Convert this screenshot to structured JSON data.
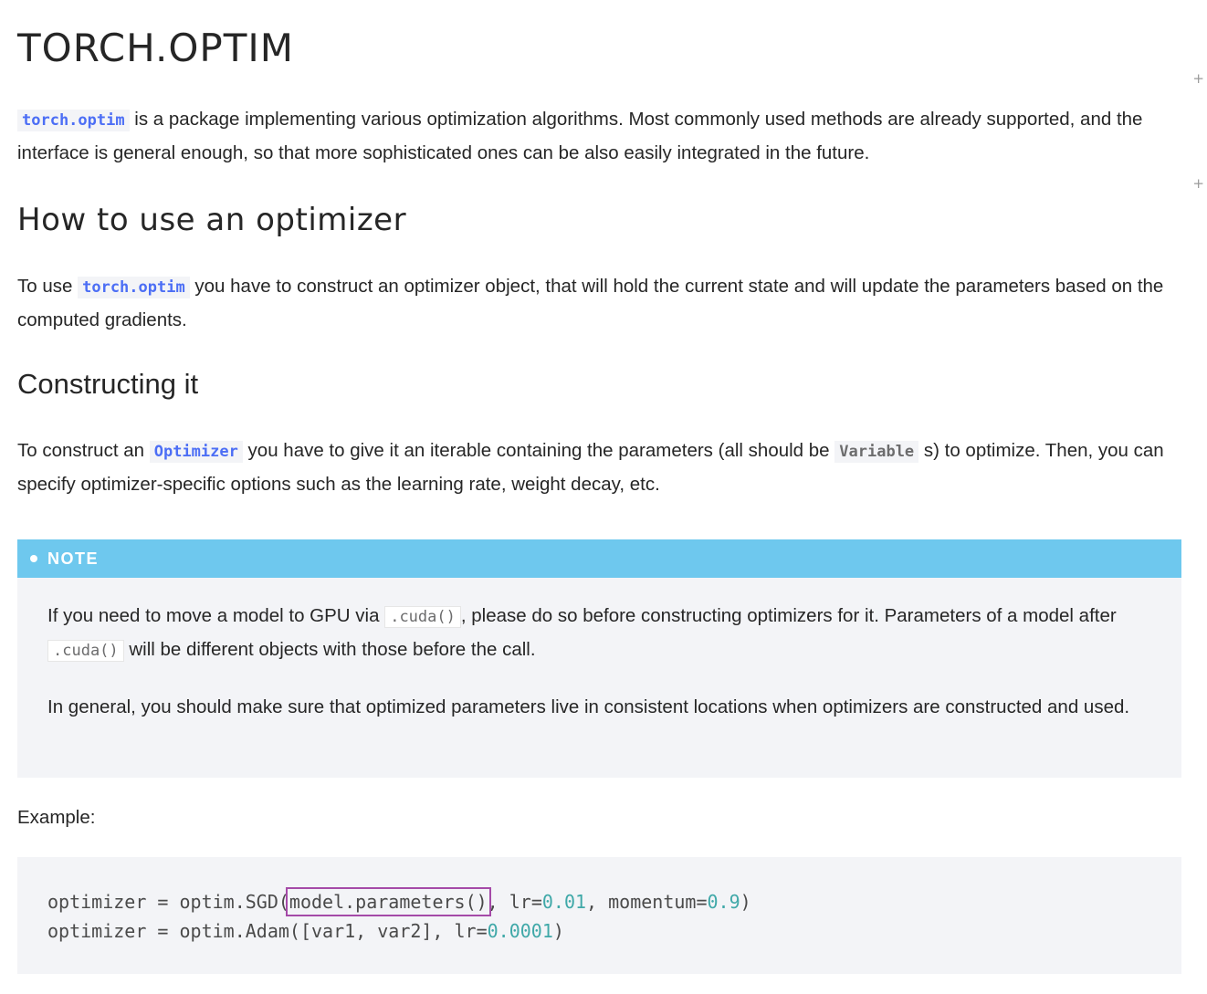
{
  "title": "TORCH.OPTIM",
  "intro": {
    "code": "torch.optim",
    "text": " is a package implementing various optimization algorithms. Most commonly used methods are already supported, and the interface is general enough, so that more sophisticated ones can be also easily integrated in the future."
  },
  "howto": {
    "heading": "How to use an optimizer",
    "text_before": "To use ",
    "code": "torch.optim",
    "text_after": " you have to construct an optimizer object, that will hold the current state and will update the parameters based on the computed gradients."
  },
  "constructing": {
    "heading": "Constructing it",
    "text_1": "To construct an ",
    "code_optimizer": "Optimizer",
    "text_2": " you have to give it an iterable containing the parameters (all should be ",
    "code_variable": "Variable",
    "text_3": " s) to optimize. Then, you can specify optimizer-specific options such as the learning rate, weight decay, etc."
  },
  "note": {
    "label": "NOTE",
    "p1_a": "If you need to move a model to GPU via ",
    "p1_code1": ".cuda()",
    "p1_b": ", please do so before constructing optimizers for it. Parameters of a model after ",
    "p1_code2": ".cuda()",
    "p1_c": " will be different objects with those before the call.",
    "p2": "In general, you should make sure that optimized parameters live in consistent locations when optimizers are constructed and used."
  },
  "example_label": "Example:",
  "code": {
    "l1_a": "optimizer = optim.SGD(",
    "l1_hl": "model.parameters()",
    "l1_b": ", lr=",
    "l1_n1": "0.01",
    "l1_c": ", momentum=",
    "l1_n2": "0.9",
    "l1_d": ")",
    "l2_a": "optimizer = optim.Adam([var1, var2], lr=",
    "l2_n1": "0.0001",
    "l2_b": ")"
  },
  "side_plus": "+",
  "colors": {
    "link": "#4c6ef5",
    "note_header": "#6ec8ee",
    "panel_bg": "#f3f4f7",
    "highlight_box": "#a54aa8",
    "number": "#3fa8a8"
  }
}
